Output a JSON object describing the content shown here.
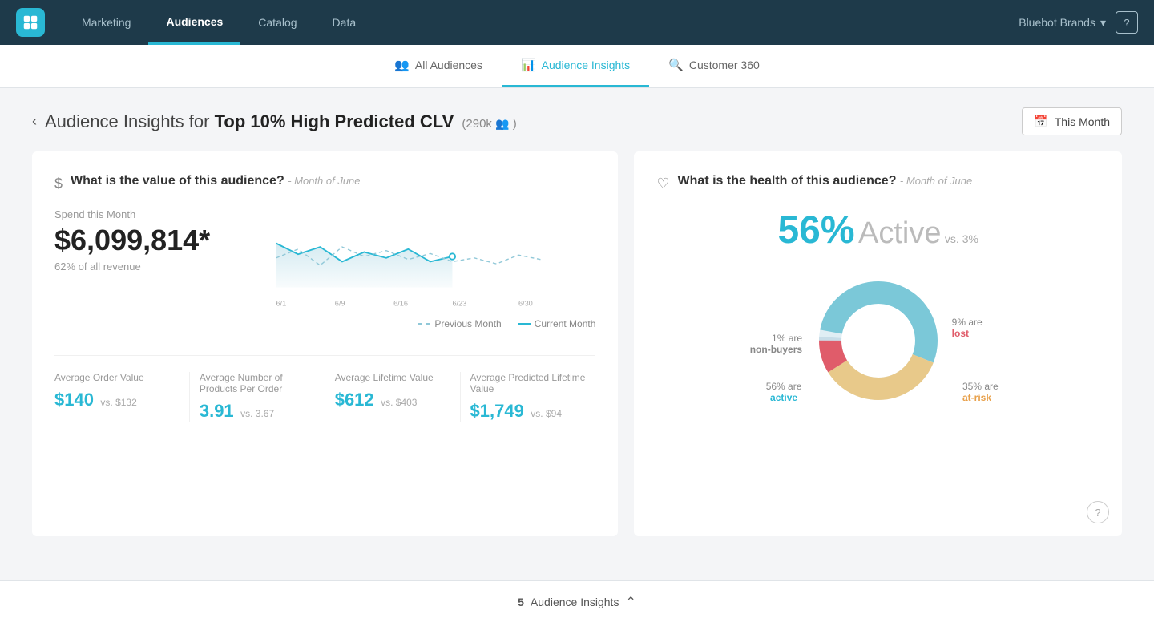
{
  "nav": {
    "links": [
      "Marketing",
      "Audiences",
      "Catalog",
      "Data"
    ],
    "active_link": "Audiences",
    "brand": "Bluebot Brands",
    "help_icon": "?"
  },
  "subtabs": [
    {
      "id": "all-audiences",
      "label": "All Audiences",
      "icon": "👥",
      "active": false
    },
    {
      "id": "audience-insights",
      "label": "Audience Insights",
      "icon": "📊",
      "active": true
    },
    {
      "id": "customer-360",
      "label": "Customer 360",
      "icon": "🔍",
      "active": false
    }
  ],
  "page": {
    "back_label": "‹",
    "title_prefix": "Audience Insights for",
    "audience_name": "Top 10% High Predicted CLV",
    "audience_count": "(290k",
    "audience_icon": "👥",
    "audience_count_close": ")",
    "month_picker_label": "This Month",
    "calendar_icon": "📅"
  },
  "value_card": {
    "icon": "$",
    "title": "What is the value of this audience?",
    "subtitle": "- Month of June",
    "spend_label": "Spend this Month",
    "spend_value": "$6,099,814*",
    "spend_sub": "62% of all revenue",
    "chart": {
      "x_labels": [
        "6/1",
        "6/9",
        "6/16",
        "6/23",
        "6/30"
      ],
      "legend_previous": "Previous Month",
      "legend_current": "Current Month"
    },
    "metrics": [
      {
        "label": "Average Order Value",
        "value": "$140",
        "vs": "vs. $132",
        "color": "teal"
      },
      {
        "label": "Average Number of Products Per Order",
        "value": "3.91",
        "vs": "vs. 3.67",
        "color": "teal"
      },
      {
        "label": "Average Lifetime Value",
        "value": "$612",
        "vs": "vs. $403",
        "color": "teal"
      },
      {
        "label": "Average Predicted Lifetime Value",
        "value": "$1,749",
        "vs": "vs. $94",
        "color": "teal"
      }
    ]
  },
  "health_card": {
    "icon": "♡",
    "title": "What is the health of this audience?",
    "subtitle": "- Month of June",
    "active_pct": "56%",
    "active_label": "Active",
    "active_vs": "vs. 3%",
    "segments": [
      {
        "label": "active",
        "pct": "56%",
        "desc": "56% are",
        "color": "#7bc8d8",
        "angle": 201.6
      },
      {
        "label": "at-risk",
        "pct": "35%",
        "desc": "35% are",
        "color": "#e8c98a",
        "angle": 126
      },
      {
        "label": "lost",
        "pct": "9%",
        "desc": "9% are",
        "color": "#e05c6a",
        "angle": 32.4
      },
      {
        "label": "non-buyers",
        "pct": "1%",
        "desc": "1% are",
        "color": "#c8dde8",
        "angle": 3.6
      }
    ],
    "question_icon": "?"
  },
  "bottom_bar": {
    "count": "5",
    "label": "Audience Insights",
    "chevron": "⌃"
  }
}
